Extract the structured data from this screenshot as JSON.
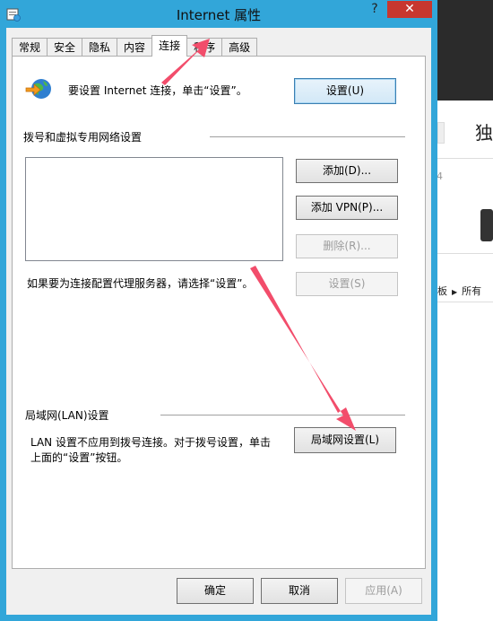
{
  "dialog": {
    "title": "Internet 属性",
    "help_label": "?",
    "close_label": "✕"
  },
  "tabs": [
    {
      "label": "常规"
    },
    {
      "label": "安全"
    },
    {
      "label": "隐私"
    },
    {
      "label": "内容"
    },
    {
      "label": "连接",
      "active": true
    },
    {
      "label": "程序"
    },
    {
      "label": "高级"
    }
  ],
  "connections": {
    "setup_text": "要设置 Internet 连接，单击“设置”。",
    "setup_button": "设置(U)",
    "dialup_group": "拨号和虚拟专用网络设置",
    "add_button": "添加(D)...",
    "add_vpn_button": "添加 VPN(P)...",
    "remove_button": "删除(R)...",
    "proxy_text": "如果要为连接配置代理服务器，请选择“设置”。",
    "settings_button": "设置(S)",
    "lan_group": "局域网(LAN)设置",
    "lan_text_line1": "LAN 设置不应用到拨号连接。对于拨号设置，单击",
    "lan_text_line2": "上面的“设置”按钮。",
    "lan_button": "局域网设置(L)"
  },
  "footer": {
    "ok": "确定",
    "cancel": "取消",
    "apply": "应用(A)"
  },
  "background": {
    "title_char": "独",
    "number": "4",
    "crumb1": "板",
    "crumb2": "所有"
  },
  "colors": {
    "window_frame": "#32a6d9",
    "close_button": "#c7372f",
    "annotation_arrow": "#f24d6b"
  }
}
